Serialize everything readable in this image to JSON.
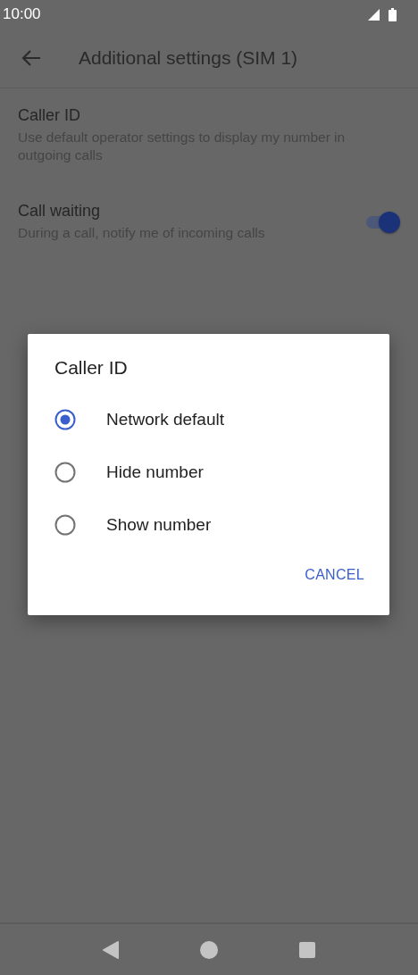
{
  "status_bar": {
    "time": "10:00"
  },
  "app_bar": {
    "title": "Additional settings (SIM 1)"
  },
  "settings": [
    {
      "kind": "text",
      "title": "Caller ID",
      "summary": "Use default operator settings to display my number in outgoing calls"
    },
    {
      "kind": "switch",
      "title": "Call waiting",
      "summary": "During a call, notify me of incoming calls",
      "on": true
    }
  ],
  "dialog": {
    "title": "Caller ID",
    "options": [
      {
        "label": "Network default",
        "selected": true
      },
      {
        "label": "Hide number",
        "selected": false
      },
      {
        "label": "Show number",
        "selected": false
      }
    ],
    "buttons": [
      "CANCEL"
    ]
  }
}
